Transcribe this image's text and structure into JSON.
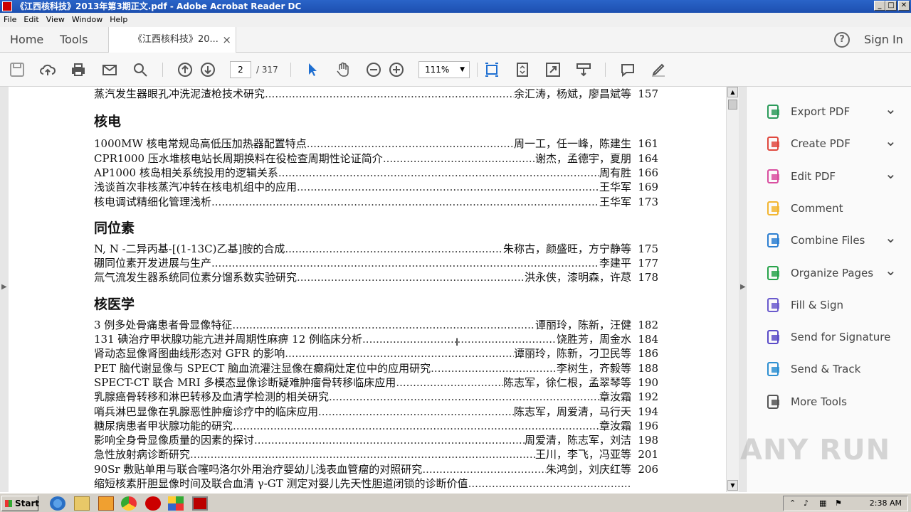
{
  "window": {
    "title": "《江西核科技》2013年第3期正文.pdf - Adobe Acrobat Reader DC",
    "min": "_",
    "max": "□",
    "close": "✕"
  },
  "menu": [
    "File",
    "Edit",
    "View",
    "Window",
    "Help"
  ],
  "tabs": {
    "home": "Home",
    "tools": "Tools",
    "doc": "《江西核科技》20...",
    "doc_close": "×",
    "help": "?",
    "signin": "Sign In"
  },
  "toolbar": {
    "page": "2",
    "total": "/  317",
    "zoom": "111%"
  },
  "doc": {
    "top_entry": {
      "title": "蒸汽发生器眼孔冲洗泥渣枪技术研究",
      "authors": "余汇涛，杨斌，廖昌斌等",
      "page": "157"
    },
    "sections": [
      {
        "heading": "核电",
        "entries": [
          {
            "title": "1000MW 核电常规岛高低压加热器配置特点",
            "authors": "周一工，任一峰，陈建生",
            "page": "161"
          },
          {
            "title": "CPR1000 压水堆核电站长周期换料在役检查周期性论证简介",
            "authors": "谢杰，孟德宇，夏朋",
            "page": "164"
          },
          {
            "title": "AP1000 核岛相关系统投用的逻辑关系",
            "authors": "周有胜",
            "page": "166"
          },
          {
            "title": "浅谈首次非核蒸汽冲转在核电机组中的应用",
            "authors": "王华军",
            "page": "169"
          },
          {
            "title": "核电调试精细化管理浅析",
            "authors": "王华军",
            "page": "173"
          }
        ]
      },
      {
        "heading": "同位素",
        "entries": [
          {
            "title": "N, N -二异丙基-[(1-13C)乙基]胺的合成",
            "authors": "朱称古，颜盛旺，方宁静等",
            "page": "175"
          },
          {
            "title": "硼同位素开发进展与生产",
            "authors": "李建平",
            "page": "177"
          },
          {
            "title": "氚气流发生器系统同位素分馏系数实验研究",
            "authors": "洪永侠，漆明森，许荩",
            "page": "178"
          }
        ]
      },
      {
        "heading": "核医学",
        "entries": [
          {
            "title": "3 例多处骨痛患者骨显像特征",
            "authors": "谭丽玲，陈新，汪健",
            "page": "182"
          },
          {
            "title": "131 碘治疗甲状腺功能亢进并周期性麻痹 12 例临床分析",
            "authors": "饶胜芳，周金水",
            "page": "184"
          },
          {
            "title": "肾动态显像肾图曲线形态对 GFR 的影响",
            "authors": "谭丽玲，陈新，刁卫民等",
            "page": "186"
          },
          {
            "title": "PET 脑代谢显像与 SPECT 脑血流灌注显像在癫痫灶定位中的应用研究",
            "authors": "李树生，齐毅等",
            "page": "188"
          },
          {
            "title": "SPECT-CT 联合 MRI 多模态显像诊断疑难肿瘤骨转移临床应用",
            "authors": "陈志军，徐仁根，孟翠琴等",
            "page": "190"
          },
          {
            "title": "乳腺癌骨转移和淋巴转移及血清学检测的相关研究",
            "authors": "章汝霜",
            "page": "192"
          },
          {
            "title": "哨兵淋巴显像在乳腺恶性肿瘤诊疗中的临床应用",
            "authors": "陈志军，周爱清，马行天",
            "page": "194"
          },
          {
            "title": "糖尿病患者甲状腺功能的研究",
            "authors": "章汝霜",
            "page": "196"
          },
          {
            "title": "影响全身骨显像质量的因素的探讨",
            "authors": "周爱清，陈志军，刘洁",
            "page": "198"
          },
          {
            "title": "急性放射病诊断研究",
            "authors": "王川，李飞，冯亚等",
            "page": "201"
          },
          {
            "title": "90Sr 敷贴单用与联合噻吗洛尔外用治疗婴幼儿浅表血管瘤的对照研究",
            "authors": "朱鸿剑，刘庆红等",
            "page": "206"
          },
          {
            "title": "缩短核素肝胆显像时间及联合血清 γ-GT 测定对婴儿先天性胆道闭锁的诊断价值",
            "authors": "",
            "page": ""
          }
        ]
      }
    ]
  },
  "rightpanel": [
    {
      "label": "Export PDF",
      "icon": "export-pdf-icon",
      "color": "#2b9b5a",
      "chev": true
    },
    {
      "label": "Create PDF",
      "icon": "create-pdf-icon",
      "color": "#e0483e",
      "chev": true
    },
    {
      "label": "Edit PDF",
      "icon": "edit-pdf-icon",
      "color": "#d94fa0",
      "chev": true
    },
    {
      "label": "Comment",
      "icon": "comment-icon",
      "color": "#f2b632",
      "chev": false
    },
    {
      "label": "Combine Files",
      "icon": "combine-files-icon",
      "color": "#2d7fd1",
      "chev": true
    },
    {
      "label": "Organize Pages",
      "icon": "organize-pages-icon",
      "color": "#27a34a",
      "chev": true
    },
    {
      "label": "Fill & Sign",
      "icon": "fill-sign-icon",
      "color": "#6a5acd",
      "chev": false
    },
    {
      "label": "Send for Signature",
      "icon": "send-signature-icon",
      "color": "#5a4bc8",
      "chev": false
    },
    {
      "label": "Send & Track",
      "icon": "send-track-icon",
      "color": "#2d8fd1",
      "chev": false
    },
    {
      "label": "More Tools",
      "icon": "more-tools-icon",
      "color": "#555555",
      "chev": false
    }
  ],
  "taskbar": {
    "start": "Start",
    "clock": "2:38 AM"
  },
  "watermark": "ANY RUN"
}
